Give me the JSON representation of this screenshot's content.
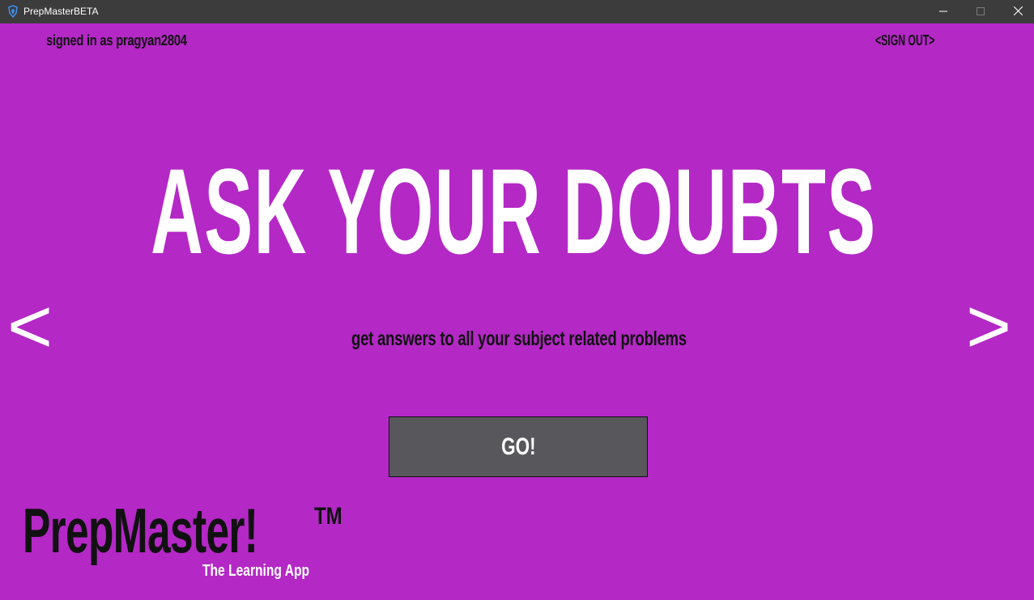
{
  "window": {
    "title": "PrepMasterBETA",
    "controls": [
      "minimize-icon",
      "maximize-icon",
      "close-icon"
    ]
  },
  "header": {
    "signed_in_text": "signed in as pragyan2804",
    "sign_out_label": "<SIGN OUT>"
  },
  "hero": {
    "headline": "ASK YOUR DOUBTS",
    "subtitle": "get answers to all your subject related problems",
    "prev_arrow": "<",
    "next_arrow": ">"
  },
  "action": {
    "go_label": "GO!"
  },
  "logo": {
    "name": "PrepMaster!",
    "trademark": "TM",
    "tagline": "The Learning App"
  },
  "colors": {
    "background": "#b428c6",
    "titlebar": "#3c3c3c",
    "button": "#58585c",
    "headline": "#ffffff",
    "dark_text": "#111111"
  }
}
